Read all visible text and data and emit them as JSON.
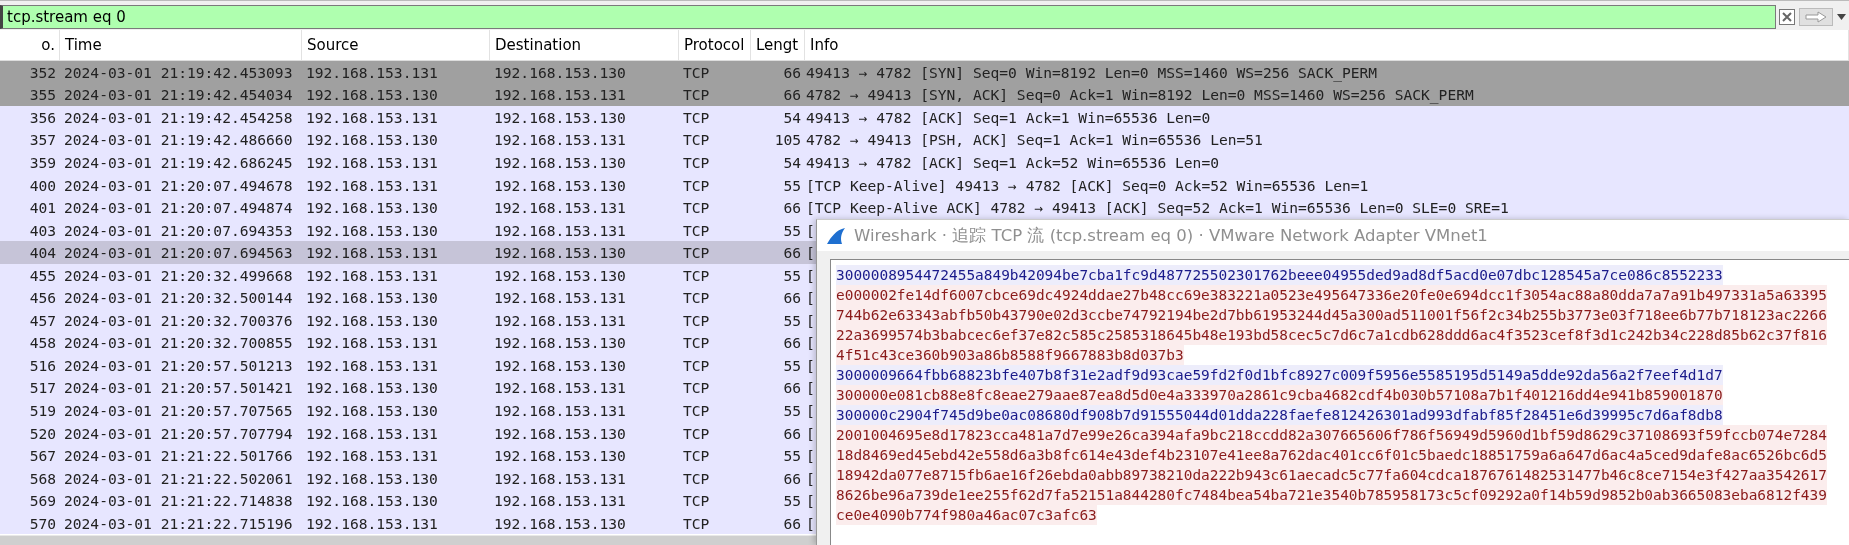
{
  "filter": {
    "value": "tcp.stream eq 0"
  },
  "columns": [
    "o.",
    "Time",
    "Source",
    "Destination",
    "Protocol",
    "Lengt",
    "Info"
  ],
  "packets": [
    {
      "no": "352",
      "time": "2024-03-01 21:19:42.453093",
      "source": "192.168.153.131",
      "destination": "192.168.153.130",
      "protocol": "TCP",
      "length": "66",
      "info": "49413 → 4782 [SYN] Seq=0 Win=8192 Len=0 MSS=1460 WS=256 SACK_PERM",
      "kind": "syn",
      "selected": false
    },
    {
      "no": "355",
      "time": "2024-03-01 21:19:42.454034",
      "source": "192.168.153.130",
      "destination": "192.168.153.131",
      "protocol": "TCP",
      "length": "66",
      "info": "4782 → 49413 [SYN, ACK] Seq=0 Ack=1 Win=8192 Len=0 MSS=1460 WS=256 SACK_PERM",
      "kind": "syn",
      "selected": false
    },
    {
      "no": "356",
      "time": "2024-03-01 21:19:42.454258",
      "source": "192.168.153.131",
      "destination": "192.168.153.130",
      "protocol": "TCP",
      "length": "54",
      "info": "49413 → 4782 [ACK] Seq=1 Ack=1 Win=65536 Len=0",
      "kind": "tcp",
      "selected": false
    },
    {
      "no": "357",
      "time": "2024-03-01 21:19:42.486660",
      "source": "192.168.153.130",
      "destination": "192.168.153.131",
      "protocol": "TCP",
      "length": "105",
      "info": "4782 → 49413 [PSH, ACK] Seq=1 Ack=1 Win=65536 Len=51",
      "kind": "tcp",
      "selected": false
    },
    {
      "no": "359",
      "time": "2024-03-01 21:19:42.686245",
      "source": "192.168.153.131",
      "destination": "192.168.153.130",
      "protocol": "TCP",
      "length": "54",
      "info": "49413 → 4782 [ACK] Seq=1 Ack=52 Win=65536 Len=0",
      "kind": "tcp",
      "selected": false
    },
    {
      "no": "400",
      "time": "2024-03-01 21:20:07.494678",
      "source": "192.168.153.131",
      "destination": "192.168.153.130",
      "protocol": "TCP",
      "length": "55",
      "info": "[TCP Keep-Alive] 49413 → 4782 [ACK] Seq=0 Ack=52 Win=65536 Len=1",
      "kind": "tcp",
      "selected": false
    },
    {
      "no": "401",
      "time": "2024-03-01 21:20:07.494874",
      "source": "192.168.153.130",
      "destination": "192.168.153.131",
      "protocol": "TCP",
      "length": "66",
      "info": "[TCP Keep-Alive ACK] 4782 → 49413 [ACK] Seq=52 Ack=1 Win=65536 Len=0 SLE=0 SRE=1",
      "kind": "tcp",
      "selected": false
    },
    {
      "no": "403",
      "time": "2024-03-01 21:20:07.694353",
      "source": "192.168.153.130",
      "destination": "192.168.153.131",
      "protocol": "TCP",
      "length": "55",
      "info": "[",
      "kind": "tcp",
      "selected": false
    },
    {
      "no": "404",
      "time": "2024-03-01 21:20:07.694563",
      "source": "192.168.153.131",
      "destination": "192.168.153.130",
      "protocol": "TCP",
      "length": "66",
      "info": "[",
      "kind": "tcp",
      "selected": true
    },
    {
      "no": "455",
      "time": "2024-03-01 21:20:32.499668",
      "source": "192.168.153.131",
      "destination": "192.168.153.130",
      "protocol": "TCP",
      "length": "55",
      "info": "[",
      "kind": "tcp",
      "selected": false
    },
    {
      "no": "456",
      "time": "2024-03-01 21:20:32.500144",
      "source": "192.168.153.130",
      "destination": "192.168.153.131",
      "protocol": "TCP",
      "length": "66",
      "info": "[",
      "kind": "tcp",
      "selected": false
    },
    {
      "no": "457",
      "time": "2024-03-01 21:20:32.700376",
      "source": "192.168.153.130",
      "destination": "192.168.153.131",
      "protocol": "TCP",
      "length": "55",
      "info": "[",
      "kind": "tcp",
      "selected": false
    },
    {
      "no": "458",
      "time": "2024-03-01 21:20:32.700855",
      "source": "192.168.153.131",
      "destination": "192.168.153.130",
      "protocol": "TCP",
      "length": "66",
      "info": "[",
      "kind": "tcp",
      "selected": false
    },
    {
      "no": "516",
      "time": "2024-03-01 21:20:57.501213",
      "source": "192.168.153.131",
      "destination": "192.168.153.130",
      "protocol": "TCP",
      "length": "55",
      "info": "[",
      "kind": "tcp",
      "selected": false
    },
    {
      "no": "517",
      "time": "2024-03-01 21:20:57.501421",
      "source": "192.168.153.130",
      "destination": "192.168.153.131",
      "protocol": "TCP",
      "length": "66",
      "info": "[",
      "kind": "tcp",
      "selected": false
    },
    {
      "no": "519",
      "time": "2024-03-01 21:20:57.707565",
      "source": "192.168.153.130",
      "destination": "192.168.153.131",
      "protocol": "TCP",
      "length": "55",
      "info": "[",
      "kind": "tcp",
      "selected": false
    },
    {
      "no": "520",
      "time": "2024-03-01 21:20:57.707794",
      "source": "192.168.153.131",
      "destination": "192.168.153.130",
      "protocol": "TCP",
      "length": "66",
      "info": "[",
      "kind": "tcp",
      "selected": false
    },
    {
      "no": "567",
      "time": "2024-03-01 21:21:22.501766",
      "source": "192.168.153.131",
      "destination": "192.168.153.130",
      "protocol": "TCP",
      "length": "55",
      "info": "[",
      "kind": "tcp",
      "selected": false
    },
    {
      "no": "568",
      "time": "2024-03-01 21:21:22.502061",
      "source": "192.168.153.130",
      "destination": "192.168.153.131",
      "protocol": "TCP",
      "length": "66",
      "info": "[",
      "kind": "tcp",
      "selected": false
    },
    {
      "no": "569",
      "time": "2024-03-01 21:21:22.714838",
      "source": "192.168.153.130",
      "destination": "192.168.153.131",
      "protocol": "TCP",
      "length": "55",
      "info": "[",
      "kind": "tcp",
      "selected": false
    },
    {
      "no": "570",
      "time": "2024-03-01 21:21:22.715196",
      "source": "192.168.153.131",
      "destination": "192.168.153.130",
      "protocol": "TCP",
      "length": "66",
      "info": "[",
      "kind": "tcp",
      "selected": false
    }
  ],
  "follow_dialog": {
    "title": "Wireshark · 追踪 TCP 流 (tcp.stream eq 0) · VMware Network Adapter VMnet1",
    "lines": [
      {
        "kind": "client",
        "text": "3000008954472455a849b42094be7cba1fc9d487725502301762beee04955ded9ad8df5acd0e07dbc128545a7ce086c8552233"
      },
      {
        "kind": "server",
        "text": "e000002fe14df6007cbce69dc4924ddae27b48cc69e383221a0523e495647336e20fe0e694dcc1f3054ac88a80dda7a7a91b497331a5a63395"
      },
      {
        "kind": "server",
        "text": "744b62e63343abfb50b43790e02d3ccbe74792194be2d7bb61953244d45a300ad511001f56f2c34b255b3773e03f718ee6b77b718123ac2266"
      },
      {
        "kind": "server",
        "text": "22a3699574b3babcec6ef37e82c585c2585318645b48e193bd58cec5c7d6c7a1cdb628ddd6ac4f3523cef8f3d1c242b34c228d85b62c37f816"
      },
      {
        "kind": "server",
        "text": "4f51c43ce360b903a86b8588f9667883b8d037b3"
      },
      {
        "kind": "client",
        "text": "3000009664fbb68823bfe407b8f31e2adf9d93cae59fd2f0d1bfc8927c009f5956e5585195d5149a5dde92da56a2f7eef4d1d7"
      },
      {
        "kind": "server",
        "text": "300000e081cb88e8fc8eae279aae87ea8d5d0e4a333970a2861c9cba4682cdf4b030b57108a7b1f401216dd4e941b859001870"
      },
      {
        "kind": "client",
        "text": "300000c2904f745d9be0ac08680df908b7d91555044d01dda228faefe812426301ad993dfabf85f28451e6d39995c7d6af8db8"
      },
      {
        "kind": "server",
        "text": "2001004695e8d17823cca481a7d7e99e26ca394afa9bc218ccdd82a307665606f786f56949d5960d1bf59d8629c37108693f59fccb074e7284"
      },
      {
        "kind": "server",
        "text": "18d8469ed45ebd42e558d6a3b8fc614e43def4b23107e41ee8a762dac401cc6f01c5baedc18851759a6a647d6ac4a5ced9dafe8ac6526bc6d5"
      },
      {
        "kind": "server",
        "text": "18942da077e8715fb6ae16f26ebda0abb89738210da222b943c61aecadc5c77fa604cdca1876761482531477b46c8ce7154e3f427aa3542617"
      },
      {
        "kind": "server",
        "text": "8626be96a739de1ee255f62d7fa52151a844280fc7484bea54ba721e3540b785958173c5cf09292a0f14b59d9852b0ab3665083eba6812f439"
      },
      {
        "kind": "server",
        "text": "ce0e4090b774f980a46ac07c3afc63"
      }
    ]
  }
}
